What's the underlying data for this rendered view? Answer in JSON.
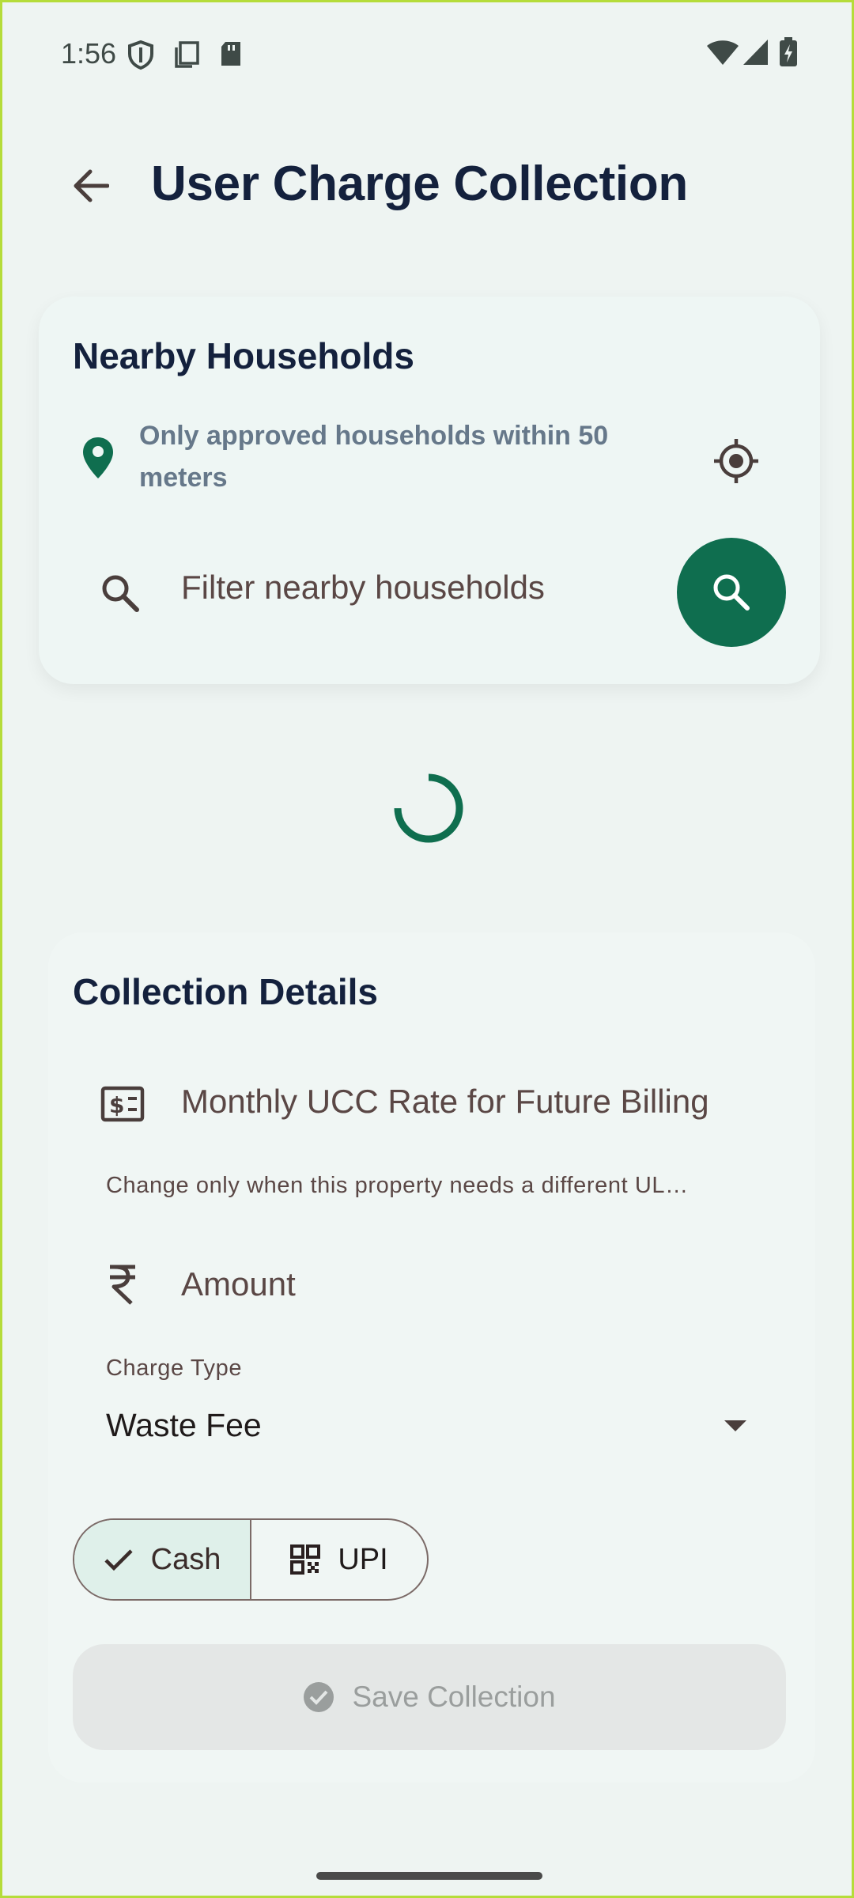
{
  "status_bar": {
    "time": "1:56",
    "icons": [
      "shield-icon",
      "copy-icon",
      "sd-card-icon",
      "wifi-icon",
      "signal-icon",
      "battery-charging-icon"
    ]
  },
  "app_bar": {
    "title": "User Charge Collection",
    "back_icon": "arrow-back-icon"
  },
  "households": {
    "title": "Nearby Households",
    "hint": "Only approved households within 50 meters",
    "filter_placeholder": "Filter nearby households",
    "accent_color": "#0f6e4f"
  },
  "loading": true,
  "collection": {
    "title": "Collection Details",
    "rate_label": "Monthly UCC Rate for Future Billing",
    "rate_helper": "Change only when this property needs a different UL…",
    "amount_label": "Amount",
    "charge_type_label": "Charge Type",
    "charge_type_value": "Waste Fee",
    "payment_modes": [
      {
        "label": "Cash",
        "selected": true,
        "icon": "check-icon"
      },
      {
        "label": "UPI",
        "selected": false,
        "icon": "qr-code-icon"
      }
    ],
    "save_label": "Save Collection",
    "save_enabled": false
  }
}
